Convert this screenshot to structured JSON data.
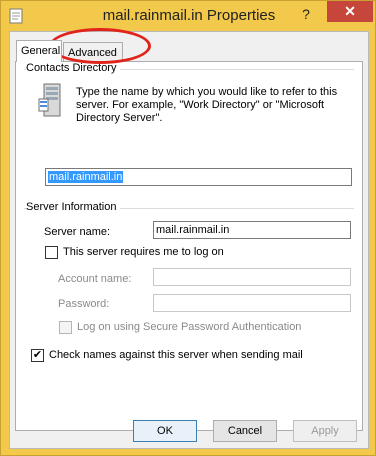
{
  "window": {
    "title": "mail.rainmail.in Properties",
    "help_label": "?",
    "close_label": "✕"
  },
  "tabs": [
    {
      "label": "General"
    },
    {
      "label": "Advanced"
    }
  ],
  "contacts_directory": {
    "heading": "Contacts Directory",
    "description": "Type the name by which you would like to refer to this server. For example, \"Work Directory\" or \"Microsoft Directory Server\".",
    "name_value": "mail.rainmail.in"
  },
  "server_information": {
    "heading": "Server Information",
    "server_name_label": "Server name:",
    "server_name_value": "mail.rainmail.in",
    "requires_logon_label": "This server requires me to log on",
    "requires_logon_checked": false,
    "account_name_label": "Account name:",
    "account_name_value": "",
    "password_label": "Password:",
    "password_value": "",
    "spa_label": "Log on using Secure Password Authentication",
    "spa_checked": false
  },
  "check_names": {
    "label": "Check names against this server when sending mail",
    "checked": true,
    "check_mark": "✔"
  },
  "buttons": {
    "ok": "OK",
    "cancel": "Cancel",
    "apply": "Apply"
  },
  "colors": {
    "frame": "#f2c94a",
    "close_button": "#c7463b",
    "selection": "#3399ff",
    "annotation_circle": "#e0241b"
  }
}
